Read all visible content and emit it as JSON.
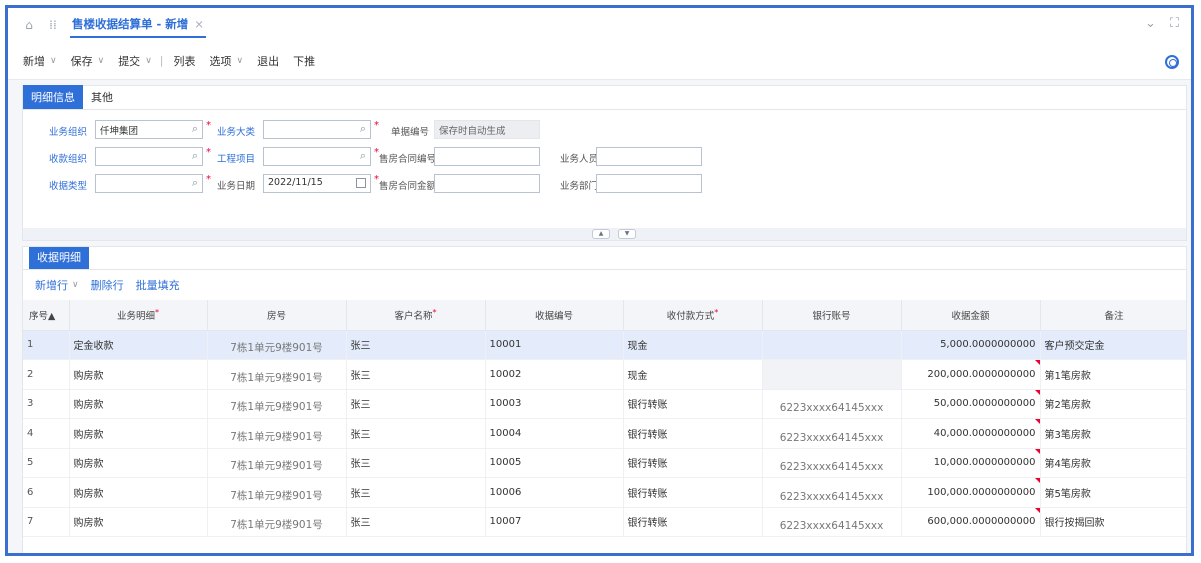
{
  "window": {
    "tab_title": "售楼收据结算单 - 新增",
    "tab_close": "×"
  },
  "toolbar": {
    "items": [
      "新增",
      "保存",
      "提交",
      "列表",
      "选项",
      "退出",
      "下推"
    ]
  },
  "header_tabs": [
    "明细信息",
    "其他"
  ],
  "form": {
    "business_org": {
      "label": "业务组织",
      "value": "仟坤集团"
    },
    "business_category": {
      "label": "业务大类",
      "value": ""
    },
    "doc_number": {
      "label": "单据编号",
      "value": "保存时自动生成"
    },
    "collect_org": {
      "label": "收款组织",
      "value": ""
    },
    "project": {
      "label": "工程项目",
      "value": ""
    },
    "contract_no": {
      "label": "售房合同编号",
      "value": ""
    },
    "salesperson": {
      "label": "业务人员",
      "value": ""
    },
    "receipt_type": {
      "label": "收据类型",
      "value": ""
    },
    "business_date": {
      "label": "业务日期",
      "value": "2022/11/15"
    },
    "contract_amount": {
      "label": "售房合同金额",
      "value": ""
    },
    "department": {
      "label": "业务部门",
      "value": ""
    },
    "required_mark": "*"
  },
  "detail_tab": "收据明细",
  "row_tools": {
    "add": "新增行",
    "delete": "删除行",
    "bulk": "批量填充"
  },
  "table": {
    "headers": [
      "序号▲",
      "业务明细",
      "房号",
      "客户名称",
      "收据编号",
      "收付款方式",
      "银行账号",
      "收据金额",
      "备注"
    ],
    "rows": [
      [
        "1",
        "定金收款",
        "7栋1单元9楼901号",
        "张三",
        "10001",
        "现金",
        "",
        "5,000.0000000000",
        "客户预交定金"
      ],
      [
        "2",
        "购房款",
        "7栋1单元9楼901号",
        "张三",
        "10002",
        "现金",
        "",
        "200,000.0000000000",
        "第1笔房款"
      ],
      [
        "3",
        "购房款",
        "7栋1单元9楼901号",
        "张三",
        "10003",
        "银行转账",
        "6223xxxx64145xxx",
        "50,000.0000000000",
        "第2笔房款"
      ],
      [
        "4",
        "购房款",
        "7栋1单元9楼901号",
        "张三",
        "10004",
        "银行转账",
        "6223xxxx64145xxx",
        "40,000.0000000000",
        "第3笔房款"
      ],
      [
        "5",
        "购房款",
        "7栋1单元9楼901号",
        "张三",
        "10005",
        "银行转账",
        "6223xxxx64145xxx",
        "10,000.0000000000",
        "第4笔房款"
      ],
      [
        "6",
        "购房款",
        "7栋1单元9楼901号",
        "张三",
        "10006",
        "银行转账",
        "6223xxxx64145xxx",
        "100,000.0000000000",
        "第5笔房款"
      ],
      [
        "7",
        "购房款",
        "7栋1单元9楼901号",
        "张三",
        "10007",
        "银行转账",
        "6223xxxx64145xxx",
        "600,000.0000000000",
        "银行按揭回款"
      ]
    ]
  }
}
